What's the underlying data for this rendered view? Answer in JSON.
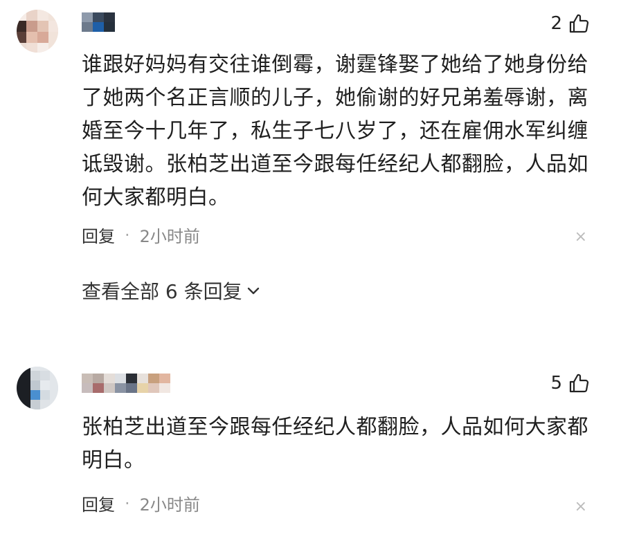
{
  "comments": [
    {
      "likes": "2",
      "text": "谁跟好妈妈有交往谁倒霉，谢霆锋娶了她给了她身份给了她两个名正言顺的儿子，她偷谢的好兄弟羞辱谢，离婚至今十几年了，私生子七八岁了，还在雇佣水军纠缠诋毁谢。张柏芝出道至今跟每任经纪人都翻脸，人品如何大家都明白。",
      "reply_label": "回复",
      "separator": "·",
      "time": "2小时前",
      "close_glyph": "×",
      "more_replies": "查看全部 6 条回复"
    },
    {
      "likes": "5",
      "text": "张柏芝出道至今跟每任经纪人都翻脸，人品如何大家都明白。",
      "reply_label": "回复",
      "separator": "·",
      "time": "2小时前",
      "close_glyph": "×"
    }
  ],
  "icons": {
    "like": "thumbs-up-icon",
    "close": "close-icon",
    "expand": "chevron-down-icon"
  },
  "colors": {
    "text": "#1f1f1f",
    "meta": "#888888",
    "close": "#bbbbbb"
  }
}
